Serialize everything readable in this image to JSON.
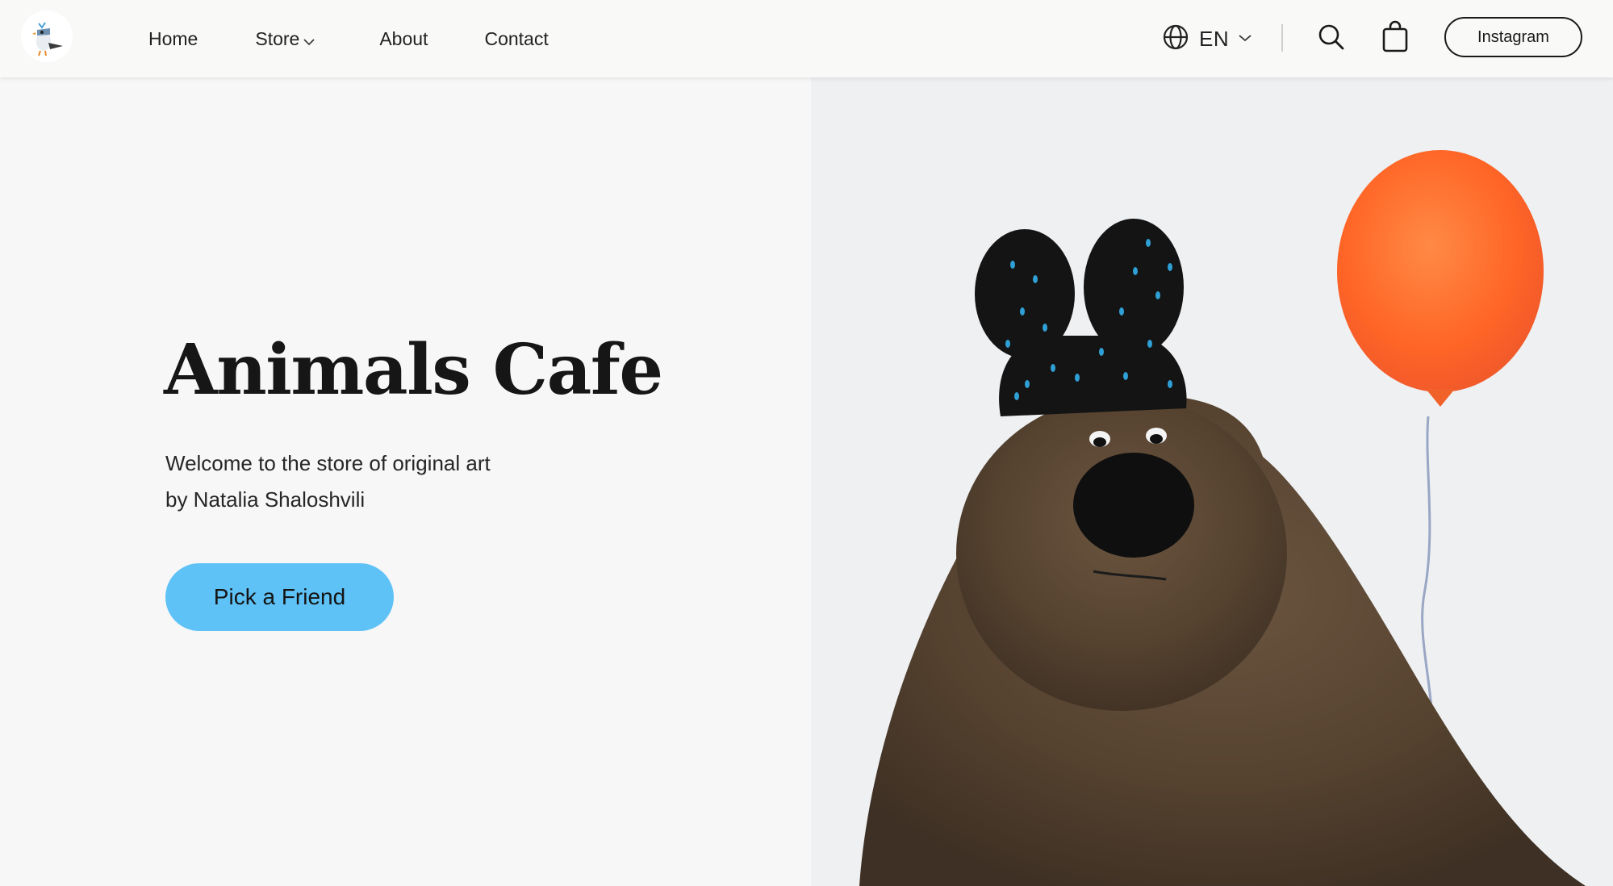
{
  "header": {
    "logo_alt": "Animals Cafe logo",
    "nav": [
      {
        "label": "Home"
      },
      {
        "label": "Store"
      },
      {
        "label": "About"
      },
      {
        "label": "Contact"
      }
    ],
    "language": {
      "selected": "EN"
    },
    "icons": {
      "logo": "bird-logo-icon",
      "store_dropdown": "chevron-down-icon",
      "language": "globe-icon",
      "language_dropdown": "chevron-down-icon",
      "search": "search-icon",
      "cart": "shopping-bag-icon"
    },
    "instagram_label": "Instagram"
  },
  "hero": {
    "title": "Animals Cafe",
    "subtitle_line1": "Welcome to the store of original art",
    "subtitle_line2": "by Natalia Shaloshvili",
    "cta_label": "Pick a Friend",
    "image": "Painted illustration of a brown bear wearing a black bunny-ear hat with blue dots, holding an orange balloon"
  },
  "colors": {
    "cta": "#5fc2f7",
    "text": "#1a1a1a",
    "background": "#f7f7f7",
    "balloon": "#ff6a2a",
    "bear": "#5a4632"
  }
}
